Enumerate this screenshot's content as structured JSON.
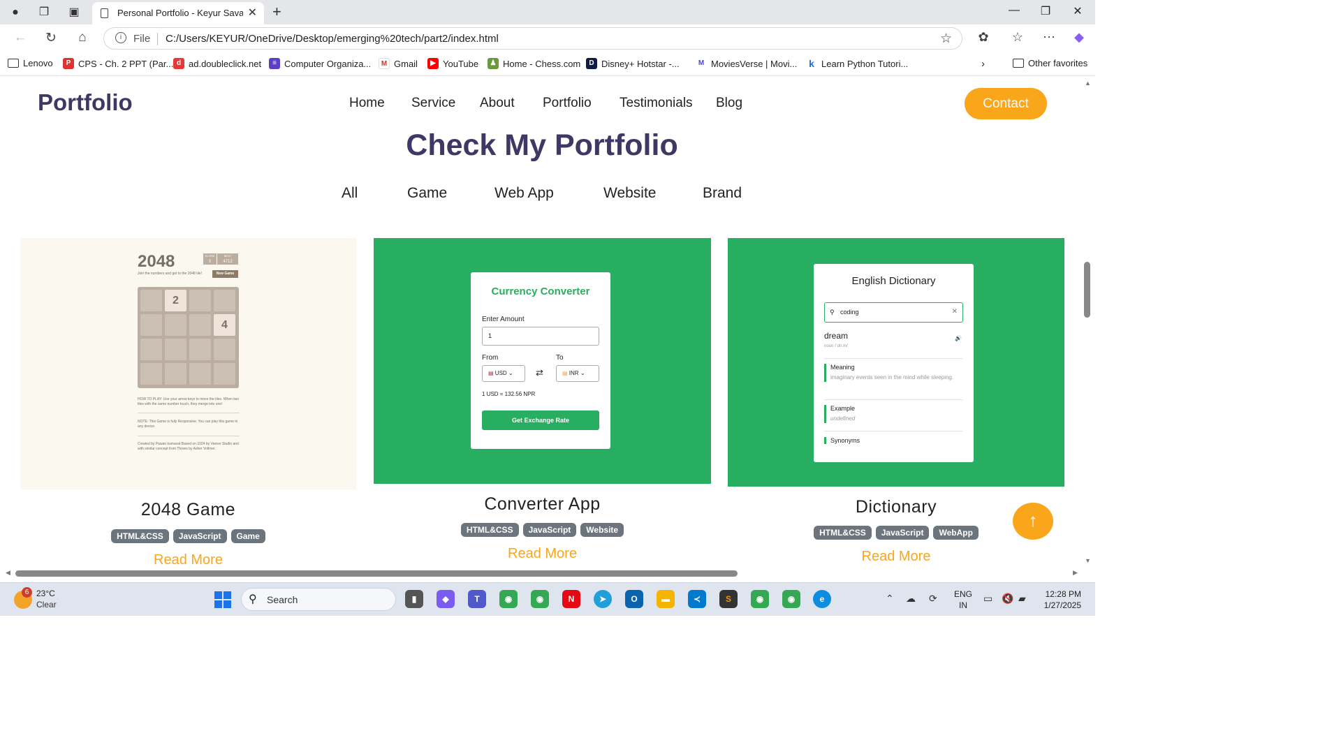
{
  "browser": {
    "tab_title": "Personal Portfolio - Keyur Savaliya",
    "url_scheme": "File",
    "url": "C:/Users/KEYUR/OneDrive/Desktop/emerging%20tech/part2/index.html",
    "bookmarks": [
      "Lenovo",
      "CPS - Ch. 2 PPT (Par...",
      "ad.doubleclick.net",
      "Computer Organiza...",
      "Gmail",
      "YouTube",
      "Home - Chess.com",
      "Disney+ Hotstar -...",
      "MoviesVerse | Movi...",
      "Learn Python Tutori..."
    ],
    "other_favorites": "Other favorites"
  },
  "site": {
    "logo": "Portfolio",
    "nav": [
      "Home",
      "Service",
      "About",
      "Portfolio",
      "Testimonials",
      "Blog"
    ],
    "contact": "Contact",
    "section_title": "Check My Portfolio",
    "filters": [
      "All",
      "Game",
      "Web App",
      "Website",
      "Brand"
    ],
    "projects": [
      {
        "title": "2048 Game",
        "tags": [
          "HTML&CSS",
          "JavaScript",
          "Game"
        ],
        "read_more": "Read More"
      },
      {
        "title": "Converter App",
        "tags": [
          "HTML&CSS",
          "JavaScript",
          "Website"
        ],
        "read_more": "Read More"
      },
      {
        "title": "Dictionary",
        "tags": [
          "HTML&CSS",
          "JavaScript",
          "WebApp"
        ],
        "read_more": "Read More"
      }
    ],
    "scroll_top_icon": "arrow-up-icon"
  },
  "game2048": {
    "title": "2048",
    "score_label": "SCORE",
    "score_value": "0",
    "best_label": "BEST",
    "best_value": "4712",
    "subtitle": "Join the numbers and get to the 2048 tile!",
    "new_game": "New Game",
    "tiles": [
      "",
      "2",
      "",
      "",
      "",
      "",
      "",
      "4",
      "",
      "",
      "",
      "",
      "",
      "",
      "",
      ""
    ],
    "how_to": "HOW TO PLAY: Use your arrow keys to move the tiles. When two tiles with the same number touch, they merge into one!",
    "note": "NOTE: This Game is fully Responsive. You can play this game in any device.",
    "credit": "Created by Pawan kumavat Based on 1024 by Veewo Studio and with similar concept from Threes by Asher Vollmer."
  },
  "converter": {
    "title": "Currency Converter",
    "amount_label": "Enter Amount",
    "amount_value": "1",
    "from_label": "From",
    "to_label": "To",
    "from_value": "USD",
    "to_value": "INR",
    "rate": "1 USD = 132.56 NPR",
    "button": "Get Exchange Rate"
  },
  "dictionary": {
    "title": "English Dictionary",
    "search_value": "coding",
    "word": "dream",
    "phonetic": "noun  /ˈdriːm/",
    "meaning_label": "Meaning",
    "meaning_text": "imaginary events seen in the mind while sleeping.",
    "example_label": "Example",
    "example_text": "undefined",
    "synonyms_label": "Synonyms"
  },
  "taskbar": {
    "weather_badge": "6",
    "temp": "23°C",
    "condition": "Clear",
    "search": "Search",
    "lang_top": "ENG",
    "lang_bottom": "IN",
    "time": "12:28 PM",
    "date": "1/27/2025"
  },
  "colors": {
    "brand_dark": "#3f3865",
    "accent_orange": "#f9a61b",
    "card_green": "#27ae60",
    "tag_gray": "#6c757d"
  }
}
